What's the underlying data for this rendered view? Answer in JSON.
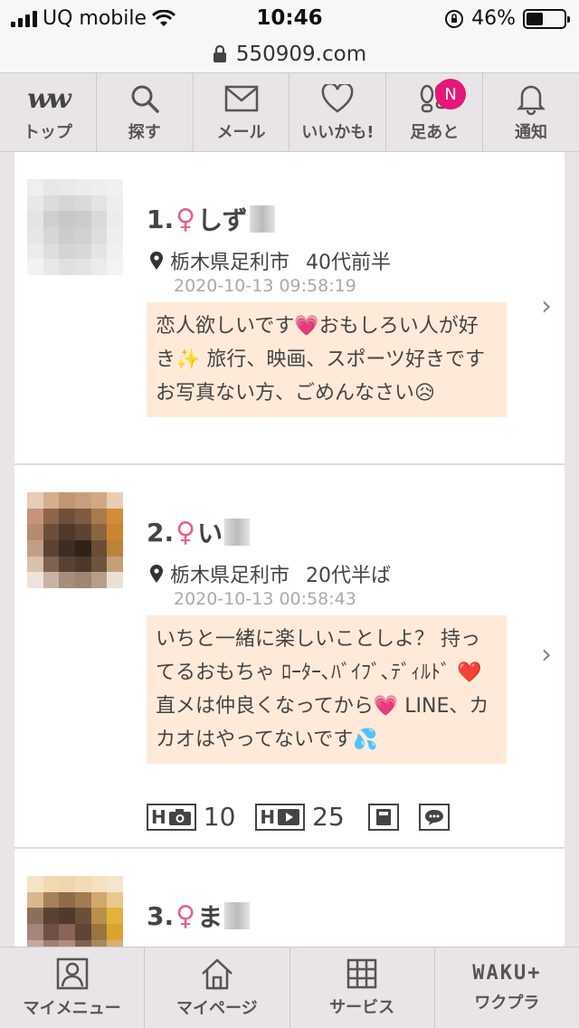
{
  "status_bar": {
    "carrier": "UQ mobile",
    "time": "10:46",
    "battery": "46%",
    "battery_fraction": 0.46
  },
  "url_bar": {
    "url": "550909.com"
  },
  "top_nav": {
    "items": [
      {
        "label": "トップ",
        "icon": "ww-logo-icon"
      },
      {
        "label": "探す",
        "icon": "search-icon"
      },
      {
        "label": "メール",
        "icon": "mail-icon"
      },
      {
        "label": "いいかも!",
        "icon": "heart-icon"
      },
      {
        "label": "足あと",
        "icon": "footprints-icon",
        "badge": "N"
      },
      {
        "label": "通知",
        "icon": "bell-icon"
      }
    ],
    "logo_text": "ww"
  },
  "profiles": [
    {
      "rank": "1.",
      "gender_symbol": "♀",
      "name": "しず",
      "location": "栃木県足利市",
      "age": "40代前半",
      "timestamp": "2020-10-13 09:58:19",
      "message": "恋人欲しいです💗おもしろい人が好き✨ 旅行、映画、スポーツ好きです お写真ない方、ごめんなさい😥"
    },
    {
      "rank": "2.",
      "gender_symbol": "♀",
      "name": "い",
      "location": "栃木県足利市",
      "age": "20代半ば",
      "timestamp": "2020-10-13 00:58:43",
      "message": "いちと一緒に楽しいことしよ？ 持ってるおもちゃ ﾛｰﾀｰ､ﾊﾞｲﾌﾞ､ﾃﾞｨﾙﾄﾞ ❤️ 直メは仲良くなってから💗 LINE、カカオはやってないです💦",
      "photo_count": "10",
      "video_count": "25",
      "photo_badge": "H",
      "video_badge": "H"
    },
    {
      "rank": "3.",
      "gender_symbol": "♀",
      "name": "ま"
    }
  ],
  "bottom_nav": {
    "items": [
      {
        "label": "マイメニュー",
        "icon": "person-icon"
      },
      {
        "label": "マイページ",
        "icon": "home-icon"
      },
      {
        "label": "サービス",
        "icon": "grid-icon"
      },
      {
        "label": "ワクプラ",
        "icon": "waku-logo",
        "logo": "WAKU+"
      }
    ]
  },
  "colors": {
    "accent_pink": "#e6177a",
    "female_symbol": "#e6618e",
    "message_bg": "#ffead9"
  }
}
